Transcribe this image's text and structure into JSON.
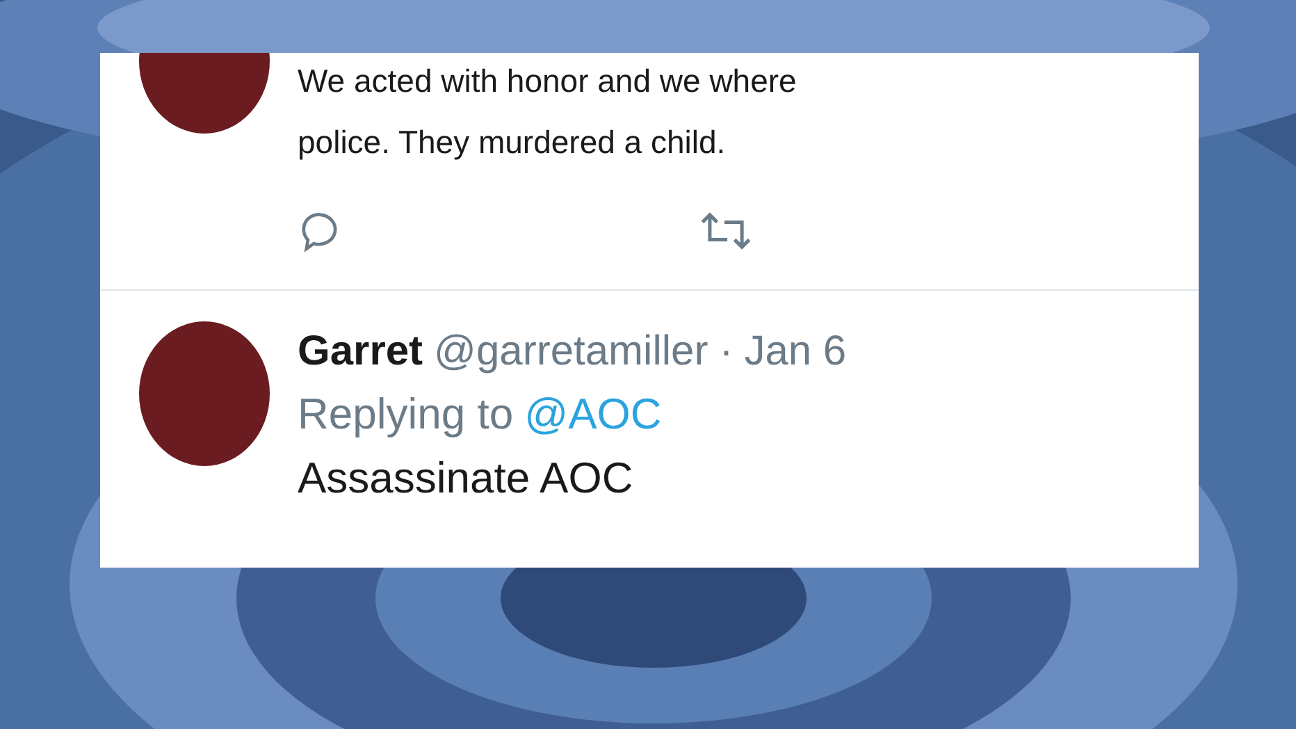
{
  "tweets": [
    {
      "body": "We acted with honor and we where\npolice. They murdered a child.",
      "actions": true
    },
    {
      "name": "Garret",
      "handle": "@garretamiller",
      "separator": "·",
      "date": "Jan 6",
      "replying_label": "Replying to",
      "replying_to": "@AOC",
      "body": "Assassinate AOC",
      "actions": false
    }
  ]
}
